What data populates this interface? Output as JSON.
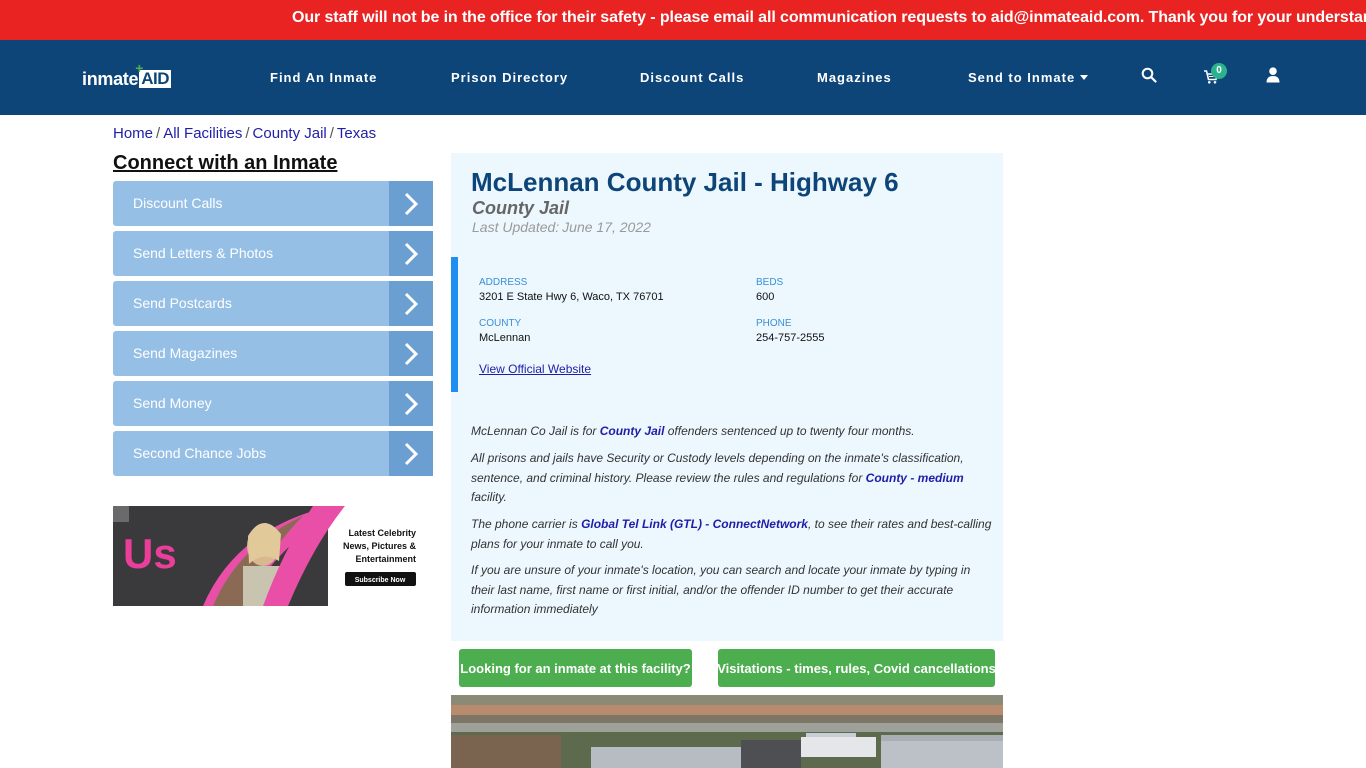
{
  "alert": {
    "text": "Our staff will not be in the office for their safety - please email all communication requests to aid@inmateaid.com. Thank you for your understanding."
  },
  "header": {
    "logo_text_inmate": "inmate",
    "logo_text_aid": "AID",
    "nav": [
      {
        "label": "Find An Inmate"
      },
      {
        "label": "Prison Directory"
      },
      {
        "label": "Discount Calls"
      },
      {
        "label": "Magazines"
      },
      {
        "label": "Send to Inmate",
        "has_dropdown": true
      }
    ],
    "icons": {
      "search": "search-icon",
      "cart": "cart-icon",
      "user": "user-icon"
    },
    "cart_count": "0"
  },
  "breadcrumb": [
    {
      "label": "Home"
    },
    {
      "label": "All Facilities"
    },
    {
      "label": "County Jail"
    },
    {
      "label": "Texas"
    }
  ],
  "breadcrumb_separator": "/",
  "sidebar": {
    "title": "Connect with an Inmate",
    "items": [
      {
        "label": "Discount Calls"
      },
      {
        "label": "Send Letters & Photos"
      },
      {
        "label": "Send Postcards"
      },
      {
        "label": "Send Magazines"
      },
      {
        "label": "Send Money"
      },
      {
        "label": "Second Chance Jobs"
      }
    ],
    "ad": {
      "brand": "Us",
      "headline_1": "Latest Celebrity",
      "headline_2": "News, Pictures &",
      "headline_3": "Entertainment",
      "cta": "Subscribe Now"
    }
  },
  "facility": {
    "title": "McLennan County Jail - Highway 6",
    "type": "County Jail",
    "last_updated_label": "Last Updated:",
    "last_updated": "June 17, 2022",
    "address_label": "Address",
    "address": "3201 E State Hwy 6, Waco, TX 76701",
    "beds_label": "Beds",
    "beds": "600",
    "county_label": "County",
    "county": "McLennan",
    "phone_label": "Phone",
    "phone": "254-757-2555",
    "website_link": "View Official Website",
    "accent_color": "#1e8ff0"
  },
  "description": {
    "p1_pre": "McLennan Co Jail is for ",
    "p1_link": "County Jail",
    "p1_post": " offenders sentenced up to twenty four months.",
    "p2_pre": "All prisons and jails have Security or Custody levels depending on the inmate's classification, sentence, and criminal history. Please review the rules and regulations for ",
    "p2_link": "County - medium",
    "p2_post": " facility.",
    "p3_pre": "The phone carrier is ",
    "p3_link": "Global Tel Link (GTL) - ConnectNetwork",
    "p3_post": ", to see their rates and best-calling plans for your inmate to call you.",
    "p4": "If you are unsure of your inmate's location, you can search and locate your inmate by typing in their last name, first name or first initial, and/or the offender ID number to get their accurate information immediately"
  },
  "actions": {
    "find_inmate": "Looking for an inmate at this facility?",
    "visitation": "Visitations - times, rules, Covid cancellations"
  }
}
